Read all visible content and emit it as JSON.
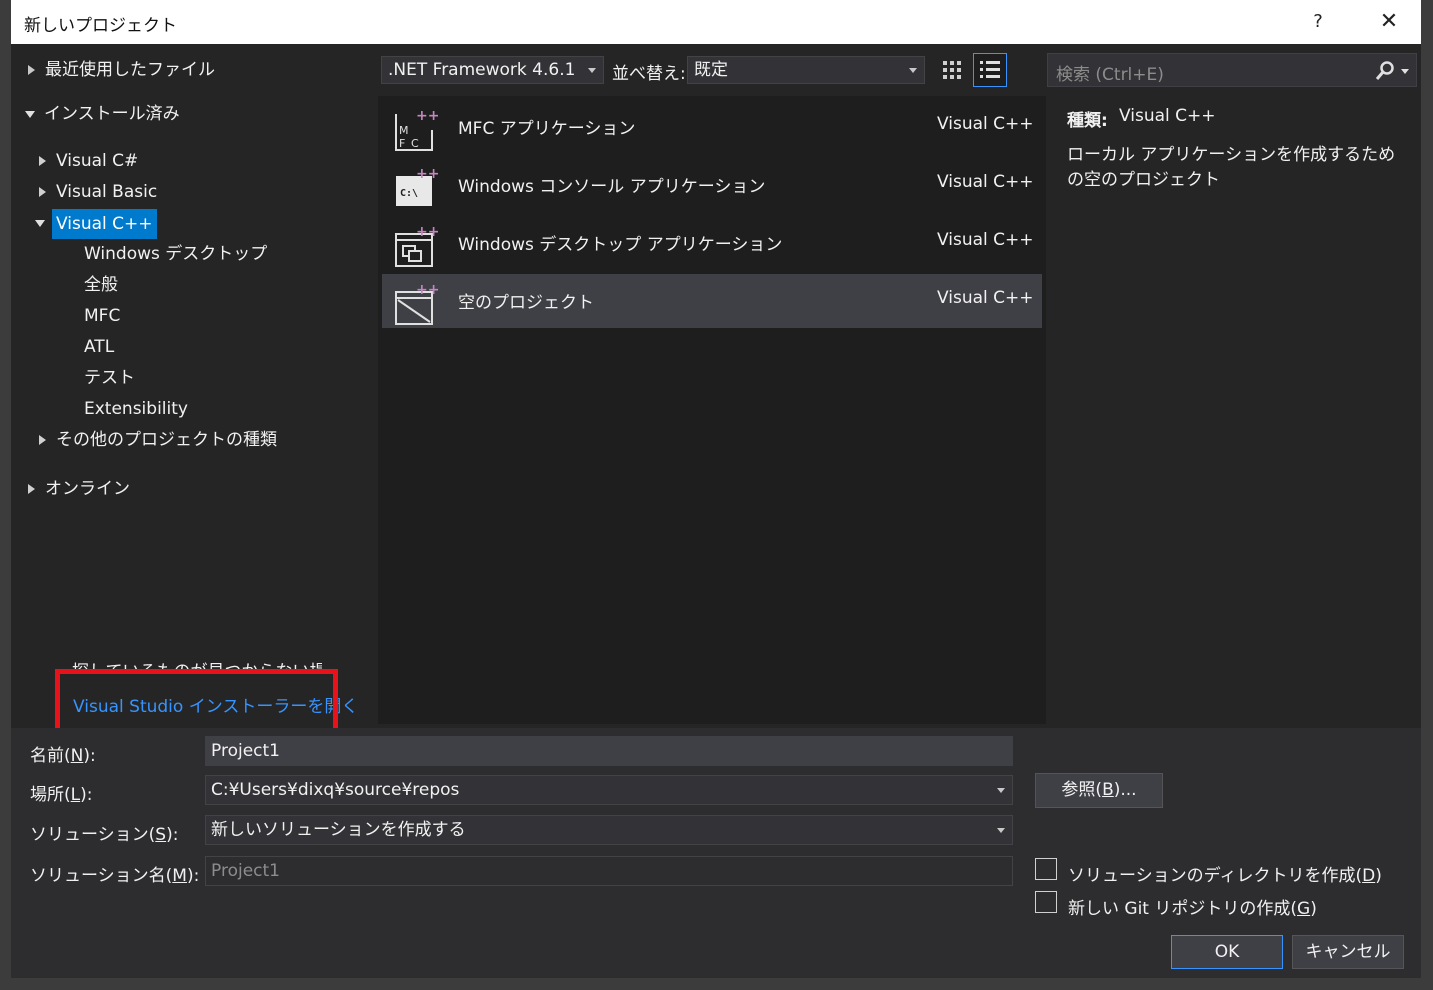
{
  "window": {
    "title": "新しいプロジェクト",
    "help": "?",
    "close": "✕"
  },
  "tree": {
    "recent": "最近使用したファイル",
    "installed": "インストール済み",
    "vcsharp": "Visual C#",
    "vbasic": "Visual Basic",
    "vcpp": "Visual C++",
    "windesktop": "Windows デスクトップ",
    "general": "全般",
    "mfc": "MFC",
    "atl": "ATL",
    "test": "テスト",
    "extensibility": "Extensibility",
    "other": "その他のプロジェクトの種類",
    "online": "オンライン"
  },
  "notfound": {
    "text": "探しているものが見つからない場合",
    "link": "Visual Studio インストーラーを開く"
  },
  "toolbar": {
    "framework": ".NET Framework 4.6.1",
    "sort_label": "並べ替え:",
    "sort_value": "既定",
    "search_placeholder": "検索 (Ctrl+E)"
  },
  "templates": [
    {
      "name": "MFC アプリケーション",
      "lang": "Visual C++"
    },
    {
      "name": "Windows コンソール アプリケーション",
      "lang": "Visual C++"
    },
    {
      "name": "Windows デスクトップ アプリケーション",
      "lang": "Visual C++"
    },
    {
      "name": "空のプロジェクト",
      "lang": "Visual C++"
    }
  ],
  "details": {
    "type_label": "種類:",
    "type_value": "Visual C++",
    "description": "ローカル アプリケーションを作成するための空のプロジェクト"
  },
  "form": {
    "name_label": "名前(",
    "name_key": "N",
    "name_value": "Project1",
    "location_label": "場所(",
    "location_key": "L",
    "location_value": "C:¥Users¥dixq¥source¥repos",
    "browse_label": "参照(",
    "browse_key": "B",
    "browse_suffix": ")...",
    "solution_label": "ソリューション(",
    "solution_key": "S",
    "solution_value": "新しいソリューションを作成する",
    "solname_label": "ソリューション名(",
    "solname_key": "M",
    "solname_value": "Project1",
    "check_dir_label": "ソリューションのディレクトリを作成(",
    "check_dir_key": "D",
    "check_git_label": "新しい Git リポジトリの作成(",
    "check_git_key": "G",
    "close_paren": ")",
    "label_suffix": "):",
    "ok": "OK",
    "cancel": "キャンセル"
  }
}
